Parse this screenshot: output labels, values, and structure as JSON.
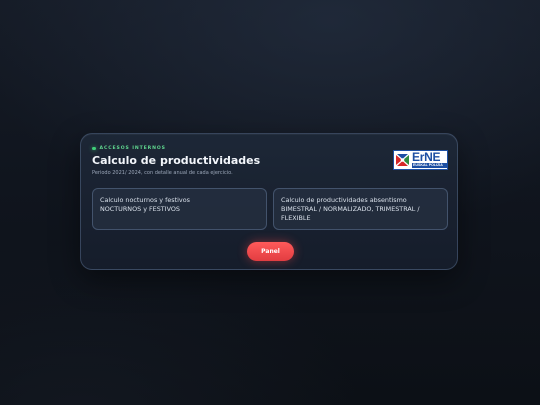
{
  "card": {
    "eyebrow": "ACCESOS INTERNOS",
    "title": "Calculo de productividades",
    "subtitle": "Periodo 2021/ 2024, con detalle anual de cada ejercicio."
  },
  "logo": {
    "text": "ErNE",
    "subtext": "EUSKAL POLIZIA"
  },
  "options": [
    {
      "line1": "Calculo nocturnos y festivos",
      "line2": "NOCTURNOS y FESTIVOS"
    },
    {
      "line1": "Calculo de productividades absentismo",
      "line2": "BIMESTRAL / NORMALIZADO, TRIMESTRAL / FLEXIBLE"
    }
  ],
  "panel_button": {
    "label": "Panel"
  },
  "colors": {
    "accent_green": "#3fcf78",
    "button_red": "#e84446",
    "logo_blue": "#1d4fa3"
  },
  "icons": {
    "status_dot": "status-dot-icon",
    "logo_mark": "ertzaintza-emblem-icon"
  }
}
